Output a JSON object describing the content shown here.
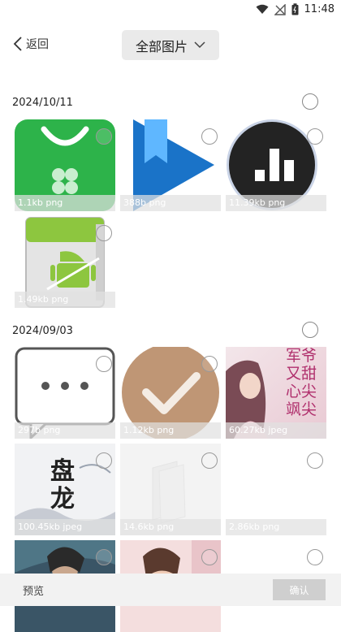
{
  "status": {
    "time": "11:48"
  },
  "header": {
    "back_label": "返回",
    "album_label": "全部图片"
  },
  "sections": [
    {
      "date": "2024/10/11"
    },
    {
      "date": "2024/09/03"
    }
  ],
  "images": [
    {
      "caption": "1.1kb png",
      "icon": "green-shopping-bag-app-icon"
    },
    {
      "caption": "388b png",
      "icon": "blue-play-bookmark-icon"
    },
    {
      "caption": "11.39kb png",
      "icon": "bar-chart-app-icon"
    },
    {
      "caption": "1.49kb png",
      "icon": "android-apk-icon"
    },
    {
      "caption": "297b png",
      "icon": "speech-bubble-dots-icon"
    },
    {
      "caption": "1.12kb png",
      "icon": "check-mark-circle-icon"
    },
    {
      "caption": "60.27kb jpeg",
      "icon": "novel-cover-image",
      "cover_text": [
        "军爷",
        "又甜",
        "心尖",
        "飒尖"
      ]
    },
    {
      "caption": "100.45kb jpeg",
      "icon": "novel-cover-panlong",
      "cover_text": [
        "盘",
        "龙"
      ]
    },
    {
      "caption": "14.6kb png",
      "icon": "faded-book-pages-icon"
    },
    {
      "caption": "2.86kb png",
      "icon": "blank-image"
    },
    {
      "caption": "",
      "icon": "fantasy-character-image"
    },
    {
      "caption": "",
      "icon": "portrait-photo-image"
    },
    {
      "caption": "",
      "icon": "blank-image"
    }
  ],
  "footer": {
    "preview_label": "预览",
    "confirm_label": "确认"
  },
  "colors": {
    "accent_green": "#2db34a",
    "play_blue": "#1a73c8",
    "dropdown_bg": "#eaeaea"
  }
}
